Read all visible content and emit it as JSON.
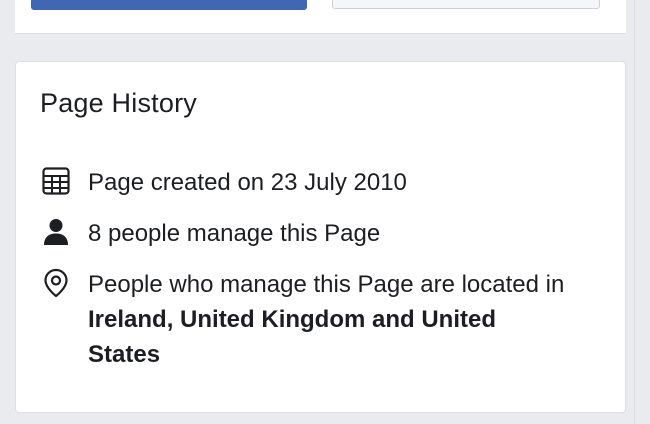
{
  "page_history": {
    "title": "Page History",
    "items": [
      {
        "icon": "calendar-icon",
        "text": "Page created on 23 July 2010"
      },
      {
        "icon": "person-icon",
        "text": "8 people manage this Page"
      },
      {
        "icon": "location-pin-icon",
        "text_prefix": "People who manage this Page are located in ",
        "text_bold": "Ireland, United Kingdom and United States"
      }
    ]
  },
  "colors": {
    "background": "#e9ebee",
    "card": "#ffffff",
    "primary_button": "#4267b2",
    "text": "#1c1e21"
  }
}
